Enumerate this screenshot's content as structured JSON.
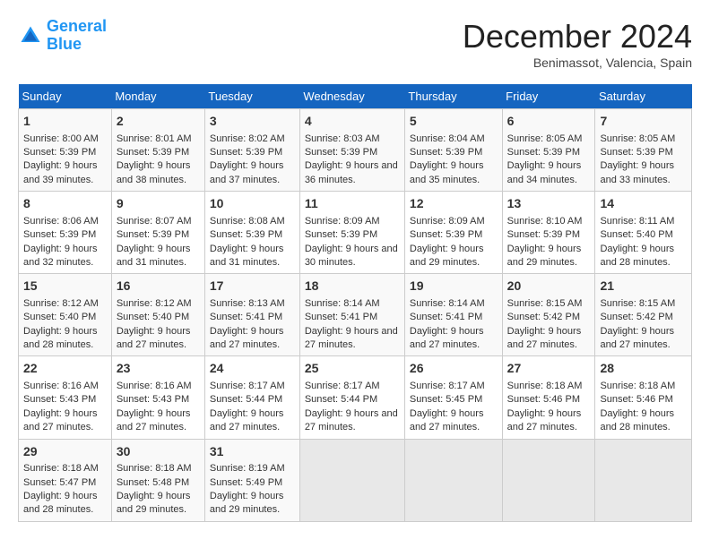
{
  "header": {
    "logo_line1": "General",
    "logo_line2": "Blue",
    "month": "December 2024",
    "location": "Benimassot, Valencia, Spain"
  },
  "days_of_week": [
    "Sunday",
    "Monday",
    "Tuesday",
    "Wednesday",
    "Thursday",
    "Friday",
    "Saturday"
  ],
  "weeks": [
    [
      {
        "day": "1",
        "sunrise": "Sunrise: 8:00 AM",
        "sunset": "Sunset: 5:39 PM",
        "daylight": "Daylight: 9 hours and 39 minutes."
      },
      {
        "day": "2",
        "sunrise": "Sunrise: 8:01 AM",
        "sunset": "Sunset: 5:39 PM",
        "daylight": "Daylight: 9 hours and 38 minutes."
      },
      {
        "day": "3",
        "sunrise": "Sunrise: 8:02 AM",
        "sunset": "Sunset: 5:39 PM",
        "daylight": "Daylight: 9 hours and 37 minutes."
      },
      {
        "day": "4",
        "sunrise": "Sunrise: 8:03 AM",
        "sunset": "Sunset: 5:39 PM",
        "daylight": "Daylight: 9 hours and 36 minutes."
      },
      {
        "day": "5",
        "sunrise": "Sunrise: 8:04 AM",
        "sunset": "Sunset: 5:39 PM",
        "daylight": "Daylight: 9 hours and 35 minutes."
      },
      {
        "day": "6",
        "sunrise": "Sunrise: 8:05 AM",
        "sunset": "Sunset: 5:39 PM",
        "daylight": "Daylight: 9 hours and 34 minutes."
      },
      {
        "day": "7",
        "sunrise": "Sunrise: 8:05 AM",
        "sunset": "Sunset: 5:39 PM",
        "daylight": "Daylight: 9 hours and 33 minutes."
      }
    ],
    [
      {
        "day": "8",
        "sunrise": "Sunrise: 8:06 AM",
        "sunset": "Sunset: 5:39 PM",
        "daylight": "Daylight: 9 hours and 32 minutes."
      },
      {
        "day": "9",
        "sunrise": "Sunrise: 8:07 AM",
        "sunset": "Sunset: 5:39 PM",
        "daylight": "Daylight: 9 hours and 31 minutes."
      },
      {
        "day": "10",
        "sunrise": "Sunrise: 8:08 AM",
        "sunset": "Sunset: 5:39 PM",
        "daylight": "Daylight: 9 hours and 31 minutes."
      },
      {
        "day": "11",
        "sunrise": "Sunrise: 8:09 AM",
        "sunset": "Sunset: 5:39 PM",
        "daylight": "Daylight: 9 hours and 30 minutes."
      },
      {
        "day": "12",
        "sunrise": "Sunrise: 8:09 AM",
        "sunset": "Sunset: 5:39 PM",
        "daylight": "Daylight: 9 hours and 29 minutes."
      },
      {
        "day": "13",
        "sunrise": "Sunrise: 8:10 AM",
        "sunset": "Sunset: 5:39 PM",
        "daylight": "Daylight: 9 hours and 29 minutes."
      },
      {
        "day": "14",
        "sunrise": "Sunrise: 8:11 AM",
        "sunset": "Sunset: 5:40 PM",
        "daylight": "Daylight: 9 hours and 28 minutes."
      }
    ],
    [
      {
        "day": "15",
        "sunrise": "Sunrise: 8:12 AM",
        "sunset": "Sunset: 5:40 PM",
        "daylight": "Daylight: 9 hours and 28 minutes."
      },
      {
        "day": "16",
        "sunrise": "Sunrise: 8:12 AM",
        "sunset": "Sunset: 5:40 PM",
        "daylight": "Daylight: 9 hours and 27 minutes."
      },
      {
        "day": "17",
        "sunrise": "Sunrise: 8:13 AM",
        "sunset": "Sunset: 5:41 PM",
        "daylight": "Daylight: 9 hours and 27 minutes."
      },
      {
        "day": "18",
        "sunrise": "Sunrise: 8:14 AM",
        "sunset": "Sunset: 5:41 PM",
        "daylight": "Daylight: 9 hours and 27 minutes."
      },
      {
        "day": "19",
        "sunrise": "Sunrise: 8:14 AM",
        "sunset": "Sunset: 5:41 PM",
        "daylight": "Daylight: 9 hours and 27 minutes."
      },
      {
        "day": "20",
        "sunrise": "Sunrise: 8:15 AM",
        "sunset": "Sunset: 5:42 PM",
        "daylight": "Daylight: 9 hours and 27 minutes."
      },
      {
        "day": "21",
        "sunrise": "Sunrise: 8:15 AM",
        "sunset": "Sunset: 5:42 PM",
        "daylight": "Daylight: 9 hours and 27 minutes."
      }
    ],
    [
      {
        "day": "22",
        "sunrise": "Sunrise: 8:16 AM",
        "sunset": "Sunset: 5:43 PM",
        "daylight": "Daylight: 9 hours and 27 minutes."
      },
      {
        "day": "23",
        "sunrise": "Sunrise: 8:16 AM",
        "sunset": "Sunset: 5:43 PM",
        "daylight": "Daylight: 9 hours and 27 minutes."
      },
      {
        "day": "24",
        "sunrise": "Sunrise: 8:17 AM",
        "sunset": "Sunset: 5:44 PM",
        "daylight": "Daylight: 9 hours and 27 minutes."
      },
      {
        "day": "25",
        "sunrise": "Sunrise: 8:17 AM",
        "sunset": "Sunset: 5:44 PM",
        "daylight": "Daylight: 9 hours and 27 minutes."
      },
      {
        "day": "26",
        "sunrise": "Sunrise: 8:17 AM",
        "sunset": "Sunset: 5:45 PM",
        "daylight": "Daylight: 9 hours and 27 minutes."
      },
      {
        "day": "27",
        "sunrise": "Sunrise: 8:18 AM",
        "sunset": "Sunset: 5:46 PM",
        "daylight": "Daylight: 9 hours and 27 minutes."
      },
      {
        "day": "28",
        "sunrise": "Sunrise: 8:18 AM",
        "sunset": "Sunset: 5:46 PM",
        "daylight": "Daylight: 9 hours and 28 minutes."
      }
    ],
    [
      {
        "day": "29",
        "sunrise": "Sunrise: 8:18 AM",
        "sunset": "Sunset: 5:47 PM",
        "daylight": "Daylight: 9 hours and 28 minutes."
      },
      {
        "day": "30",
        "sunrise": "Sunrise: 8:18 AM",
        "sunset": "Sunset: 5:48 PM",
        "daylight": "Daylight: 9 hours and 29 minutes."
      },
      {
        "day": "31",
        "sunrise": "Sunrise: 8:19 AM",
        "sunset": "Sunset: 5:49 PM",
        "daylight": "Daylight: 9 hours and 29 minutes."
      },
      null,
      null,
      null,
      null
    ]
  ]
}
